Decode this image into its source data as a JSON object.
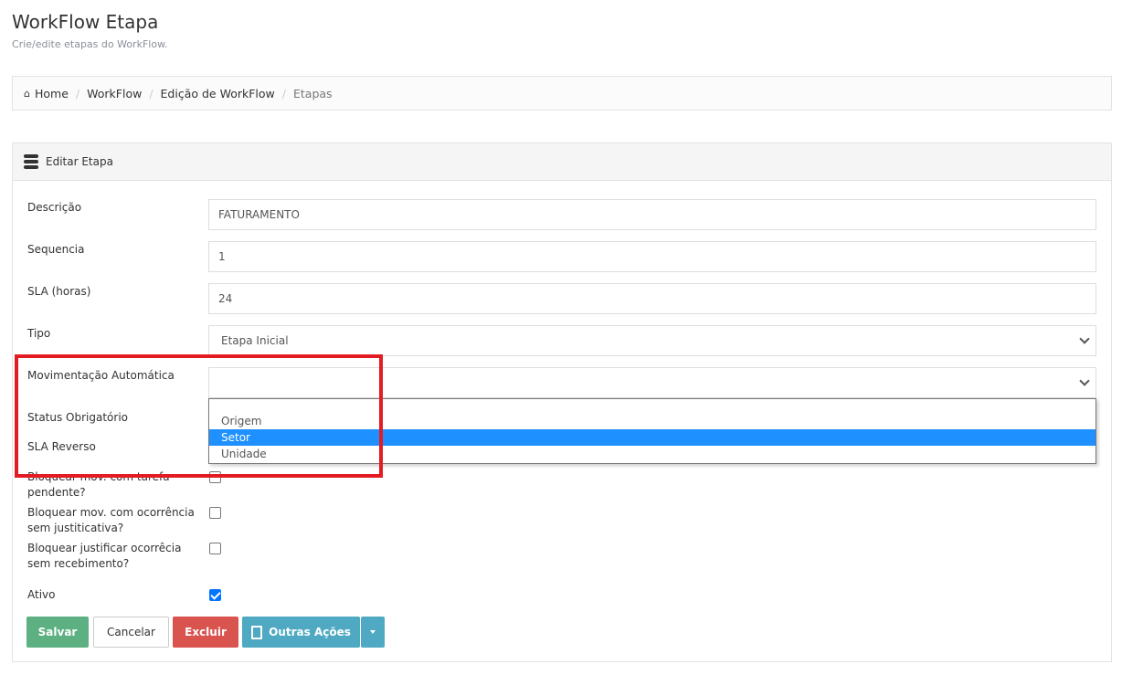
{
  "page": {
    "title": "WorkFlow Etapa",
    "subtitle": "Crie/edite etapas do WorkFlow."
  },
  "breadcrumb": [
    {
      "label": "Home",
      "icon": "home-icon"
    },
    {
      "label": "WorkFlow"
    },
    {
      "label": "Edição de WorkFlow"
    },
    {
      "label": "Etapas"
    }
  ],
  "panel": {
    "title": "Editar Etapa",
    "icon": "bars-icon"
  },
  "form": {
    "descricao": {
      "label": "Descrição",
      "value": "FATURAMENTO"
    },
    "sequencia": {
      "label": "Sequencia",
      "value": "1"
    },
    "sla": {
      "label": "SLA (horas)",
      "value": "24"
    },
    "tipo": {
      "label": "Tipo",
      "value": "Etapa Inicial"
    },
    "movimentacao": {
      "label": "Movimentação Automática",
      "value": "",
      "options": [
        "",
        "Origem",
        "Setor",
        "Unidade"
      ],
      "highlighted": "Setor"
    },
    "status_obrigatorio": {
      "label": "Status Obrigatório"
    },
    "sla_reverso": {
      "label": "SLA Reverso"
    },
    "bloquear_tarefa": {
      "label1": "Bloquear mov. com tarefa",
      "label2": "pendente?",
      "checked": false
    },
    "bloquear_ocorrencia": {
      "label1": "Bloquear mov. com ocorrência",
      "label2": "sem justiticativa?",
      "checked": false
    },
    "bloquear_justificar": {
      "label1": "Bloquear justificar ocorrêcia",
      "label2": "sem recebimento?",
      "checked": false
    },
    "ativo": {
      "label": "Ativo",
      "checked": true
    }
  },
  "buttons": {
    "salvar": "Salvar",
    "cancelar": "Cancelar",
    "excluir": "Excluir",
    "outras": "Outras Ações"
  },
  "colors": {
    "salvar": "#5cb082",
    "excluir": "#d9534f",
    "outras": "#4fa9c2",
    "highlight": "#1e90ff",
    "annotation": "#e31b23"
  }
}
